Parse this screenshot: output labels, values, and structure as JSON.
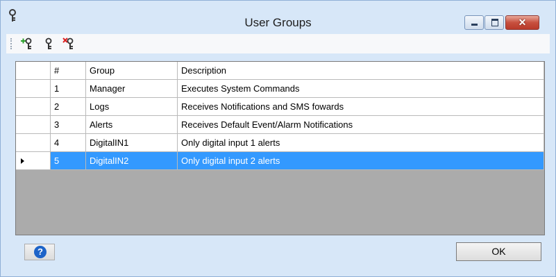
{
  "window": {
    "title": "User Groups",
    "close_glyph": "✕"
  },
  "toolbar": {
    "icons": [
      "add-group-icon",
      "edit-group-icon",
      "delete-group-icon"
    ]
  },
  "grid": {
    "columns": [
      "",
      "#",
      "Group",
      "Description"
    ],
    "rows": [
      {
        "num": "1",
        "group": "Manager",
        "description": "Executes System Commands",
        "selected": false
      },
      {
        "num": "2",
        "group": "Logs",
        "description": "Receives Notifications and SMS fowards",
        "selected": false
      },
      {
        "num": "3",
        "group": "Alerts",
        "description": "Receives Default Event/Alarm Notifications",
        "selected": false
      },
      {
        "num": "4",
        "group": "DigitalIN1",
        "description": "Only digital input 1 alerts",
        "selected": false
      },
      {
        "num": "5",
        "group": "DigitalIN2",
        "description": "Only digital input 2 alerts",
        "selected": true
      }
    ]
  },
  "buttons": {
    "help_glyph": "?",
    "ok_label": "OK"
  },
  "colors": {
    "selection": "#3399ff",
    "window_frame": "#d7e7f8",
    "empty_grid": "#ababab",
    "close_button": "#c7503f"
  }
}
